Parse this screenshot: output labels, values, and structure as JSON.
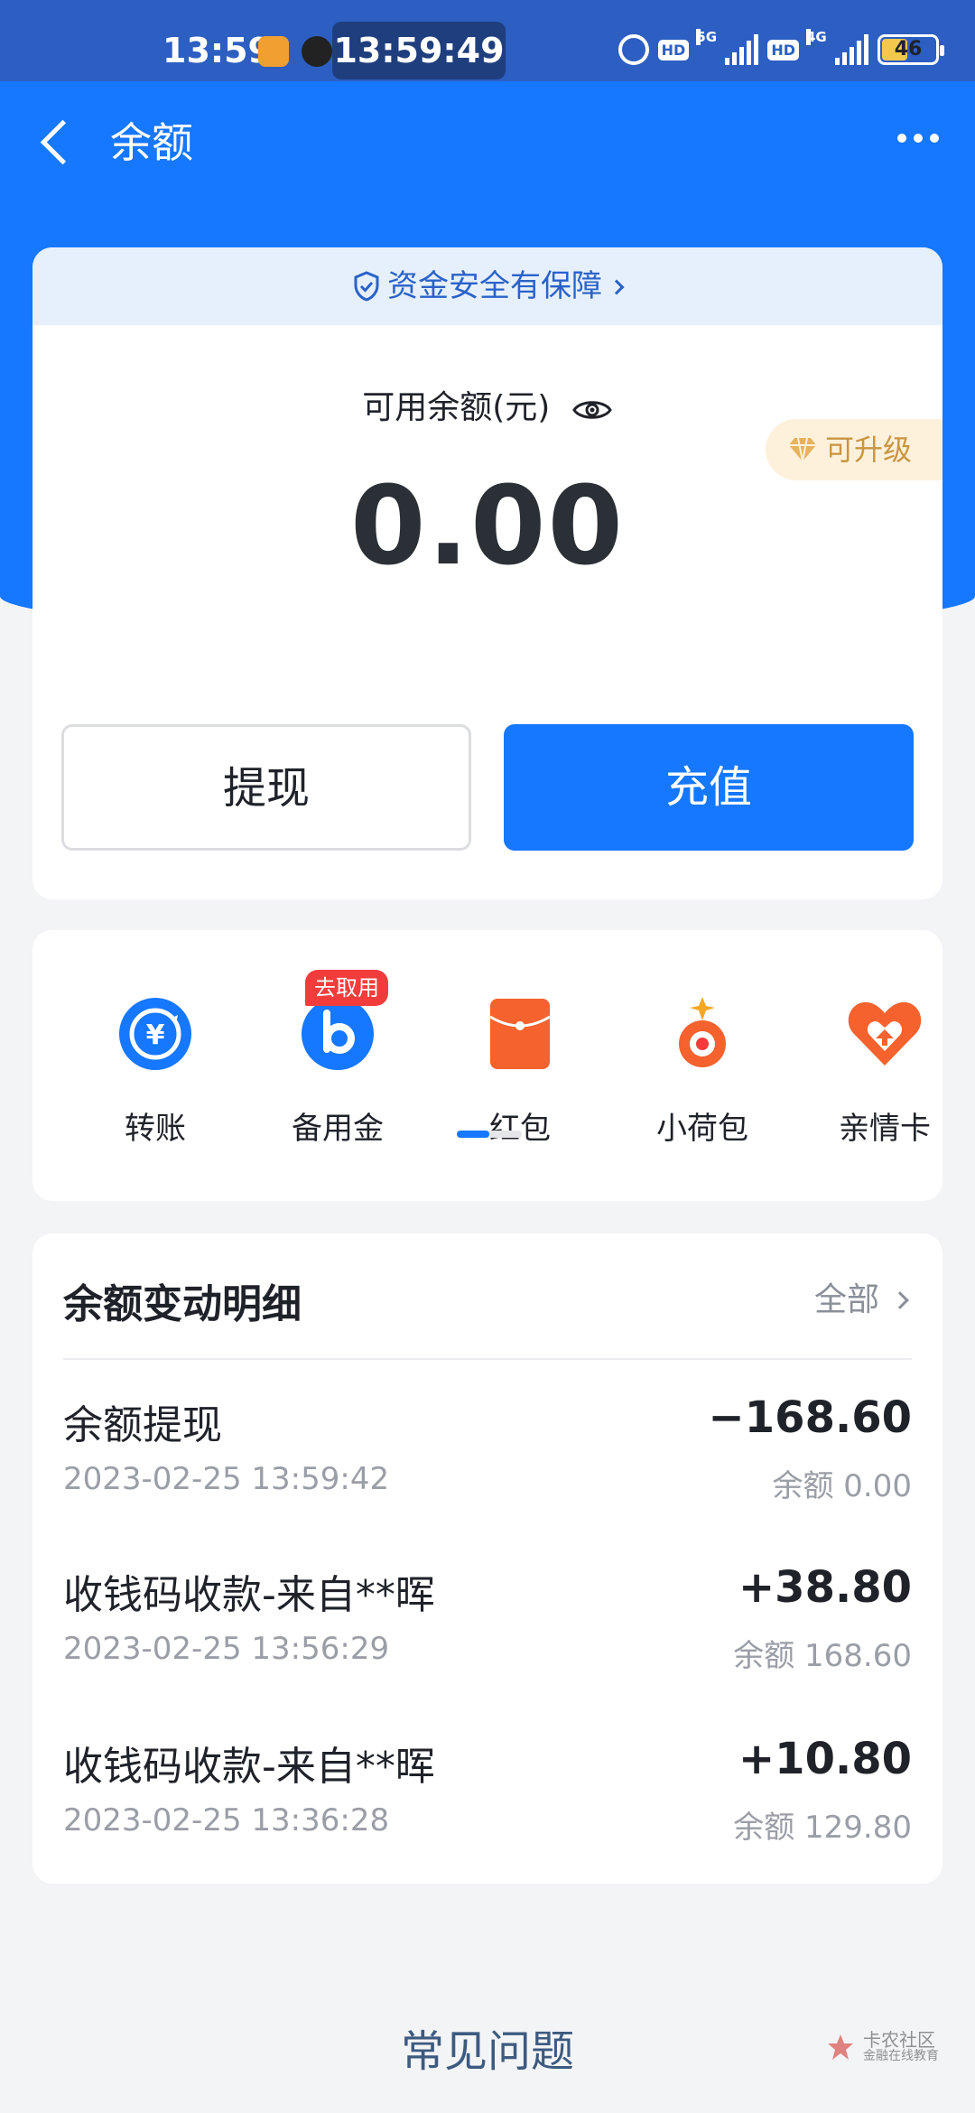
{
  "status_bar": {
    "time": "13:59",
    "clock_overlay": "13:59:49",
    "network_1": "5G",
    "network_2": "4G",
    "hd_label": "HD",
    "battery": "46"
  },
  "nav": {
    "title": "余额"
  },
  "balance_card": {
    "security_text": "资金安全有保障",
    "label": "可用余额(元)",
    "amount": "0.00",
    "upgrade_label": "可升级",
    "withdraw_label": "提现",
    "recharge_label": "充值"
  },
  "shortcuts": {
    "items": [
      {
        "label": "转账",
        "icon": "transfer-icon"
      },
      {
        "label": "备用金",
        "icon": "reserve-fund-icon"
      },
      {
        "label": "红包",
        "icon": "red-packet-icon"
      },
      {
        "label": "小荷包",
        "icon": "small-pouch-icon"
      },
      {
        "label": "亲情卡",
        "icon": "family-card-icon"
      }
    ],
    "promo_badge": "去取用",
    "colors": {
      "blue": "#1677ff",
      "orange": "#f5622d",
      "red": "#f23c3c"
    }
  },
  "transactions": {
    "title": "余额变动明细",
    "filter_label": "全部",
    "items": [
      {
        "name": "余额提现",
        "time": "2023-02-25 13:59:42",
        "amount": "−168.60",
        "balance": "余额 0.00"
      },
      {
        "name": "收钱码收款-来自**晖",
        "time": "2023-02-25 13:56:29",
        "amount": "+38.80",
        "balance": "余额 168.60"
      },
      {
        "name": "收钱码收款-来自**晖",
        "time": "2023-02-25 13:36:28",
        "amount": "+10.80",
        "balance": "余额 129.80"
      }
    ]
  },
  "footer": {
    "faq_label": "常见问题",
    "watermark_line1": "卡农社区",
    "watermark_line2": "金融在线教育"
  }
}
